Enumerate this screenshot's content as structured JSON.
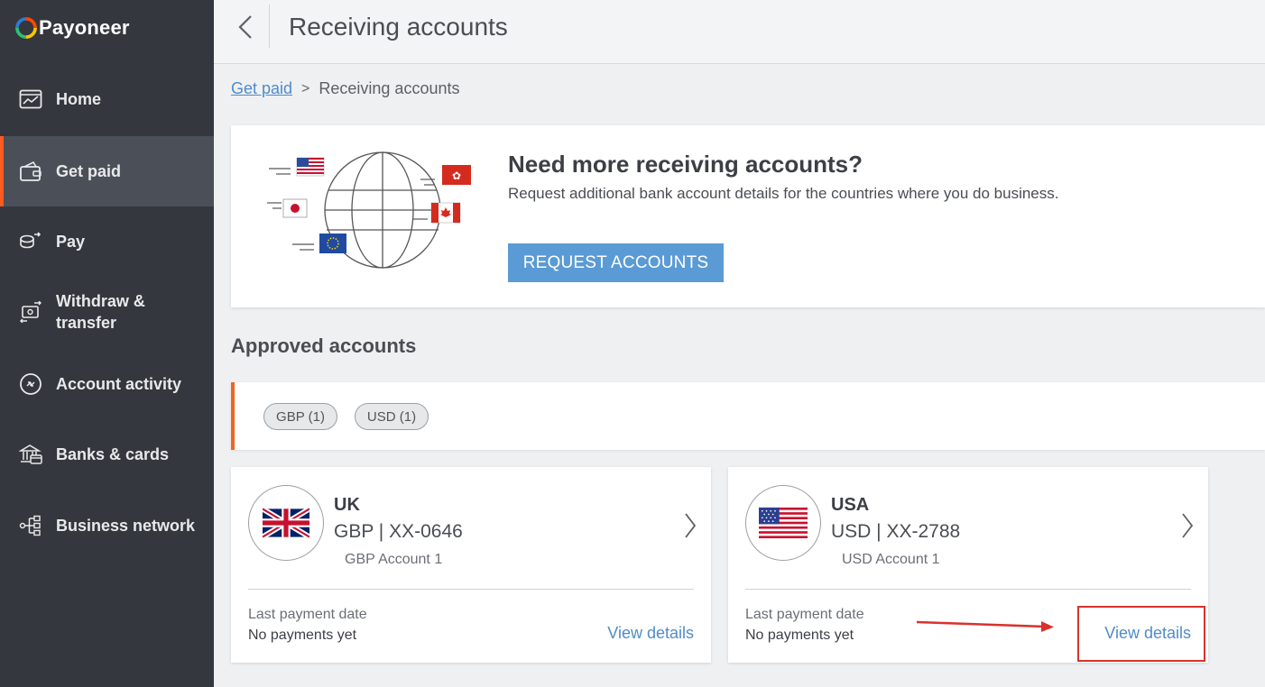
{
  "brand": {
    "name": "Payoneer"
  },
  "sidebar": {
    "items": [
      {
        "label": "Home",
        "icon": "chart-icon",
        "active": false
      },
      {
        "label": "Get paid",
        "icon": "wallet-icon",
        "active": true
      },
      {
        "label": "Pay",
        "icon": "pay-icon",
        "active": false
      },
      {
        "label": "Withdraw &",
        "label2": "transfer",
        "icon": "transfer-icon",
        "active": false
      },
      {
        "label": "Account activity",
        "icon": "activity-icon",
        "active": false
      },
      {
        "label": "Banks & cards",
        "icon": "bank-icon",
        "active": false
      },
      {
        "label": "Business network",
        "icon": "network-icon",
        "active": false
      }
    ]
  },
  "header": {
    "title": "Receiving accounts"
  },
  "breadcrumb": {
    "parent": "Get paid",
    "current": "Receiving accounts"
  },
  "promo": {
    "title": "Need more receiving accounts?",
    "subtitle": "Request additional bank account details for the countries where you do business.",
    "button": "REQUEST ACCOUNTS"
  },
  "approved": {
    "title": "Approved accounts",
    "filters": [
      "GBP (1)",
      "USD (1)"
    ],
    "accounts": [
      {
        "country": "UK",
        "number": "GBP | XX-0646",
        "name": "GBP Account 1",
        "last_payment_label": "Last payment date",
        "last_payment_value": "No payments yet",
        "action": "View details"
      },
      {
        "country": "USA",
        "number": "USD | XX-2788",
        "name": "USD Account 1",
        "last_payment_label": "Last payment date",
        "last_payment_value": "No payments yet",
        "action": "View details"
      }
    ]
  },
  "colors": {
    "sidebar": "#34373d",
    "accent": "#f26522",
    "link": "#4f8cc9",
    "button": "#5a9bd5",
    "annotation": "#d8322d"
  }
}
